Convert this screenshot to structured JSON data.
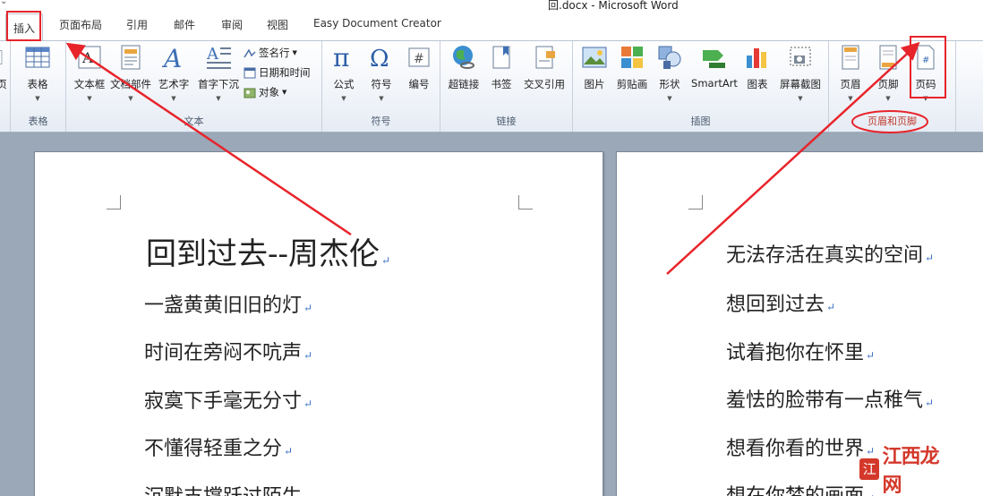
{
  "window": {
    "title": "回.docx - Microsoft Word"
  },
  "tabs": [
    "插入",
    "页面布局",
    "引用",
    "邮件",
    "审阅",
    "视图",
    "Easy Document Creator"
  ],
  "ribbon": {
    "page_group_partial": "页",
    "table": {
      "label": "表格",
      "group": "表格"
    },
    "text": {
      "group": "文本",
      "buttons": [
        "文本框",
        "文档部件",
        "艺术字",
        "首字下沉"
      ],
      "small": [
        "签名行",
        "日期和时间",
        "对象"
      ]
    },
    "symbols": {
      "group": "符号",
      "buttons": [
        "公式",
        "符号",
        "编号"
      ]
    },
    "links": {
      "group": "链接",
      "buttons": [
        "超链接",
        "书签",
        "交叉引用"
      ]
    },
    "illustrations": {
      "group": "插图",
      "buttons": [
        "图片",
        "剪贴画",
        "形状",
        "SmartArt",
        "图表",
        "屏幕截图"
      ]
    },
    "header_footer": {
      "group": "页眉和页脚",
      "buttons": [
        "页眉",
        "页脚",
        "页码"
      ]
    }
  },
  "document": {
    "left_title": "回到过去--周杰伦",
    "left_lines": [
      "一盏黄黄旧旧的灯",
      "时间在旁闷不吭声",
      "寂寞下手毫无分寸",
      "不懂得轻重之分",
      "沉默支撑跃过陌生"
    ],
    "right_lines": [
      "无法存活在真实的空间",
      "想回到过去",
      "试着抱你在怀里",
      "羞怯的脸带有一点稚气",
      "想看你看的世界",
      "想在你梦的画面"
    ],
    "paragraph_mark": "↵"
  },
  "watermark": {
    "text": "江西龙网",
    "seal": "江"
  },
  "colors": {
    "annotation": "#e8242b",
    "ribbon_bg": "#eef2f8",
    "doc_bg": "#9aa8b8"
  }
}
